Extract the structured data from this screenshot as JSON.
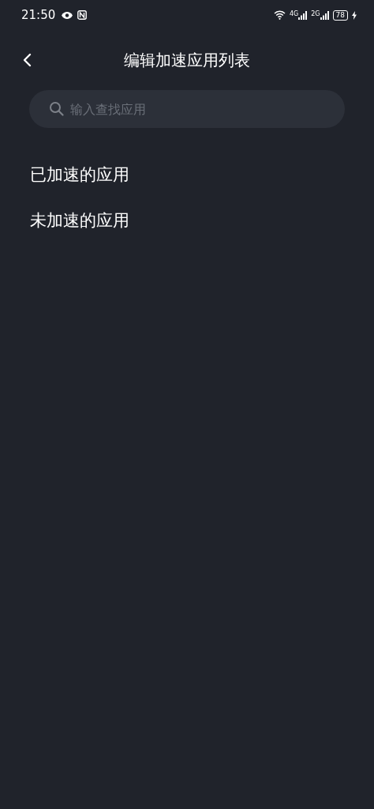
{
  "status_bar": {
    "time": "21:50",
    "network_labels": [
      "4G",
      "2G"
    ],
    "battery": "78"
  },
  "header": {
    "title": "编辑加速应用列表"
  },
  "search": {
    "placeholder": "输入查找应用"
  },
  "sections": [
    {
      "title": "已加速的应用"
    },
    {
      "title": "未加速的应用"
    }
  ]
}
